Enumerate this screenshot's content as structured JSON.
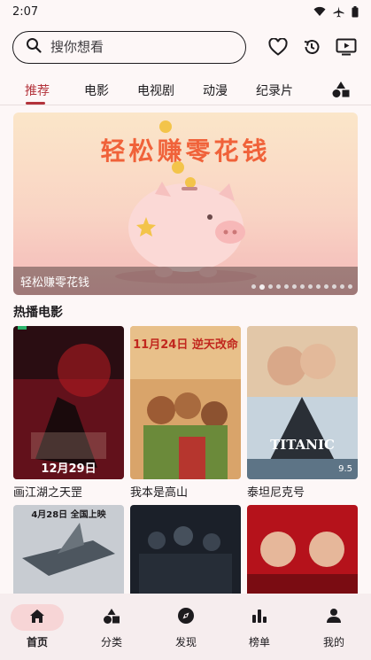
{
  "status_bar": {
    "time": "2:07"
  },
  "search": {
    "placeholder": "搜你想看"
  },
  "tabs": [
    {
      "label": "推荐",
      "active": true
    },
    {
      "label": "电影"
    },
    {
      "label": "电视剧"
    },
    {
      "label": "动漫"
    },
    {
      "label": "纪录片"
    }
  ],
  "banner": {
    "headline": "轻松赚零花钱",
    "caption": "轻松赚零花钱",
    "dot_count": 13,
    "active_dot": 1
  },
  "section": {
    "title": "热播电影"
  },
  "movies": [
    {
      "title": "画江湖之天罡",
      "poster_text": "12月29日"
    },
    {
      "title": "我本是高山",
      "poster_text": "11月24日 逆天改命"
    },
    {
      "title": "泰坦尼克号",
      "poster_text": "TITANIC",
      "rating": "9.5"
    },
    {
      "title": "",
      "poster_text": "4月28日 全国上映"
    },
    {
      "title": "",
      "poster_text": ""
    },
    {
      "title": "",
      "poster_text": ""
    }
  ],
  "bottom_nav": [
    {
      "label": "首页",
      "icon": "home-icon",
      "active": true
    },
    {
      "label": "分类",
      "icon": "category-icon"
    },
    {
      "label": "发现",
      "icon": "compass-icon"
    },
    {
      "label": "榜单",
      "icon": "chart-icon"
    },
    {
      "label": "我的",
      "icon": "person-icon"
    }
  ],
  "colors": {
    "accent": "#b3333b",
    "background": "#fdf7f7",
    "nav_pill": "#f7d5d6"
  }
}
